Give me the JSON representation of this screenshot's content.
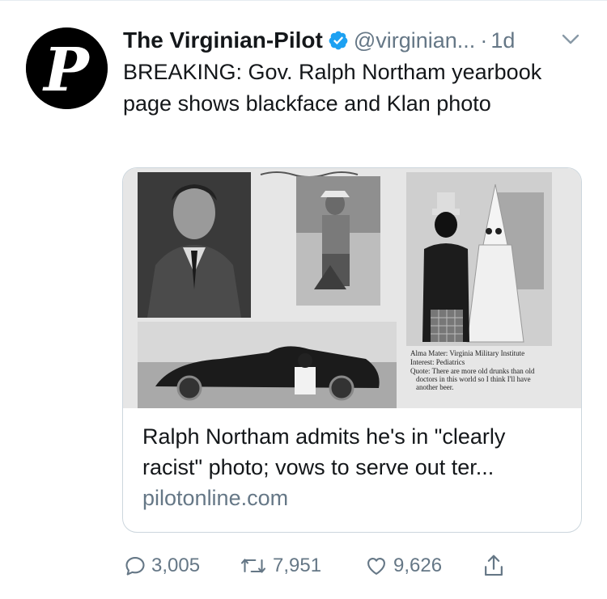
{
  "tweet": {
    "author_name": "The Virginian-Pilot",
    "verified": true,
    "handle": "@virginian...",
    "separator": "·",
    "time": "1d",
    "text": "BREAKING: Gov. Ralph Northam yearbook page shows blackface and Klan photo",
    "avatar_letter": "P"
  },
  "card": {
    "image_caption": {
      "line1": "Alma Mater: Virginia Military Institute",
      "line2": "Interest: Pediatrics",
      "line3": "Quote: There are more old drunks than old",
      "line4": "doctors in this world so I think I'll have",
      "line5": "another beer."
    },
    "title": "Ralph Northam admits he's in \"clearly racist\" photo; vows to serve out ter...",
    "domain": "pilotonline.com"
  },
  "actions": {
    "replies": "3,005",
    "retweets": "7,951",
    "likes": "9,626"
  },
  "colors": {
    "text": "#14171a",
    "secondary": "#657786",
    "verified": "#1da1f2",
    "border": "#ccd6dd"
  },
  "icons": [
    "verified-badge-icon",
    "chevron-down-icon",
    "reply-icon",
    "retweet-icon",
    "like-icon",
    "share-icon"
  ]
}
